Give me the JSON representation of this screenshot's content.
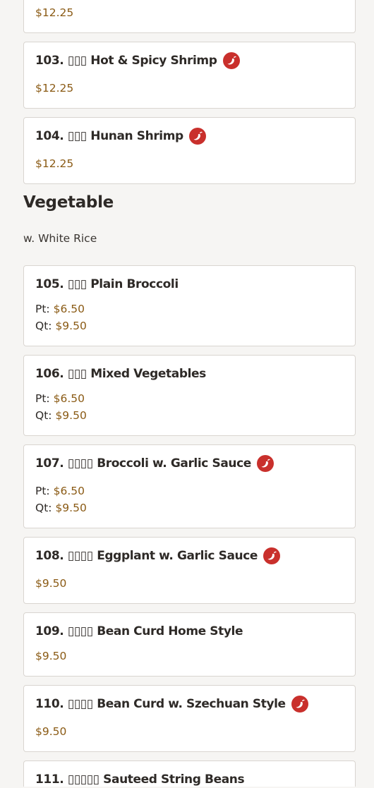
{
  "items": {
    "i102": {
      "price": "$12.25"
    },
    "i103": {
      "name": "103. ▯▯▯ Hot & Spicy Shrimp",
      "price": "$12.25"
    },
    "i104": {
      "name": "104. ▯▯▯ Hunan Shrimp",
      "price": "$12.25"
    },
    "i105": {
      "name": "105. ▯▯▯ Plain Broccoli",
      "pt_label": "Pt:",
      "pt_price": "$6.50",
      "qt_label": "Qt:",
      "qt_price": "$9.50"
    },
    "i106": {
      "name": "106. ▯▯▯ Mixed Vegetables",
      "pt_label": "Pt:",
      "pt_price": "$6.50",
      "qt_label": "Qt:",
      "qt_price": "$9.50"
    },
    "i107": {
      "name": "107. ▯▯▯▯ Broccoli w. Garlic Sauce",
      "pt_label": "Pt:",
      "pt_price": "$6.50",
      "qt_label": "Qt:",
      "qt_price": "$9.50"
    },
    "i108": {
      "name": "108. ▯▯▯▯ Eggplant w. Garlic Sauce",
      "price": "$9.50"
    },
    "i109": {
      "name": "109. ▯▯▯▯ Bean Curd Home Style",
      "price": "$9.50"
    },
    "i110": {
      "name": "110. ▯▯▯▯ Bean Curd w. Szechuan Style",
      "price": "$9.50"
    },
    "i111": {
      "name": "111. ▯▯▯▯▯ Sauteed String Beans"
    }
  },
  "section": {
    "title": "Vegetable",
    "subtitle": "w. White Rice"
  },
  "icons": {
    "spicy": "chili-pepper-icon"
  },
  "colors": {
    "price": "#8a5a14",
    "spicy_badge": "#c9302c",
    "card_border": "#d9d5d0"
  }
}
